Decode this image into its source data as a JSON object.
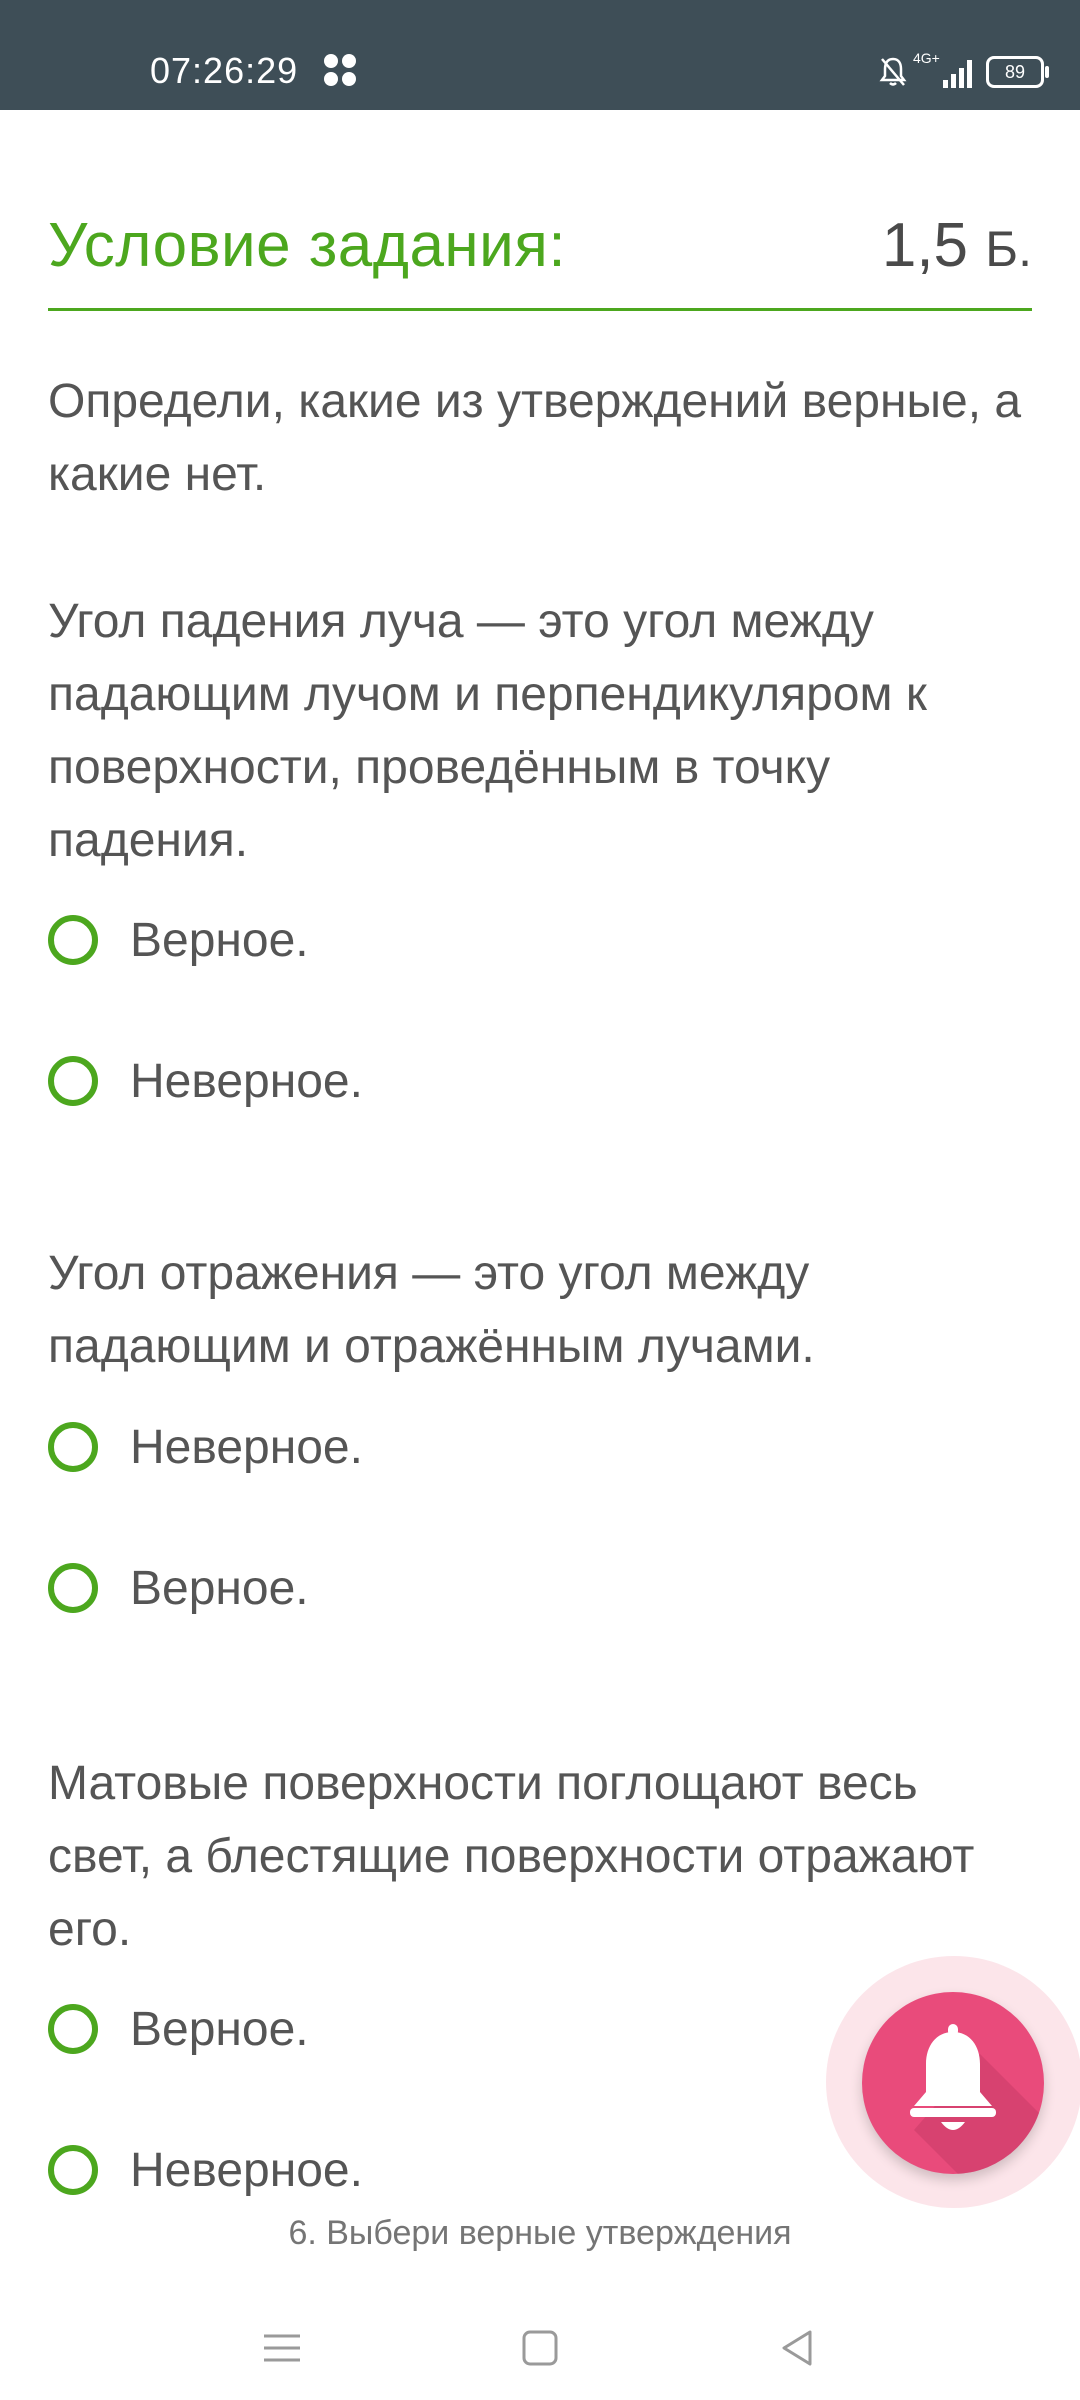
{
  "status_bar": {
    "time": "07:26:29",
    "network": "4G+",
    "battery": "89",
    "icons": [
      "notification-dots-icon",
      "bell-off-icon",
      "signal-4g-icon",
      "battery-icon"
    ]
  },
  "task": {
    "title": "Условие задания:",
    "points_value": "1,5",
    "points_unit": "Б."
  },
  "instruction": "Определи, какие из утверждений верные, а какие нет.",
  "questions": [
    {
      "statement": "Угол падения луча — это угол между падающим лучом и перпендикуляром к поверхности, проведённым в точку падения.",
      "options": [
        "Верное.",
        "Неверное."
      ]
    },
    {
      "statement": "Угол отражения — это угол между падающим и отражённым лучами.",
      "options": [
        "Неверное.",
        "Верное."
      ]
    },
    {
      "statement": "Матовые поверхности поглощают весь свет, а блестящие поверхности отражают его.",
      "options": [
        "Верное.",
        "Неверное."
      ]
    }
  ],
  "footer_caption": "6. Выбери верные утверждения",
  "colors": {
    "accent": "#4ca71e",
    "status_bar": "#3e4e57",
    "fab": "#e94b7b"
  }
}
